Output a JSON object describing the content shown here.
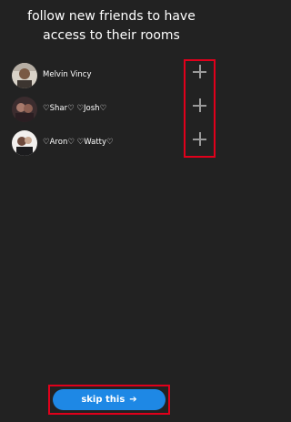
{
  "header": {
    "title_line1": "follow new friends to have",
    "title_line2": "access to their rooms"
  },
  "users": [
    {
      "name": "Melvin Vincy",
      "avatar_icon": "profile-photo",
      "action_icon": "plus-icon"
    },
    {
      "name": "♡Shar♡ ♡Josh♡",
      "avatar_icon": "profile-photo",
      "action_icon": "plus-icon"
    },
    {
      "name": "♡Aron♡ ♡Watty♡",
      "avatar_icon": "profile-photo",
      "action_icon": "plus-icon"
    }
  ],
  "footer": {
    "skip_label": "skip this",
    "skip_arrow": "➔"
  },
  "colors": {
    "background": "#222222",
    "accent": "#1e88e5",
    "highlight": "#e0001b",
    "icon": "#9a9a9a"
  }
}
